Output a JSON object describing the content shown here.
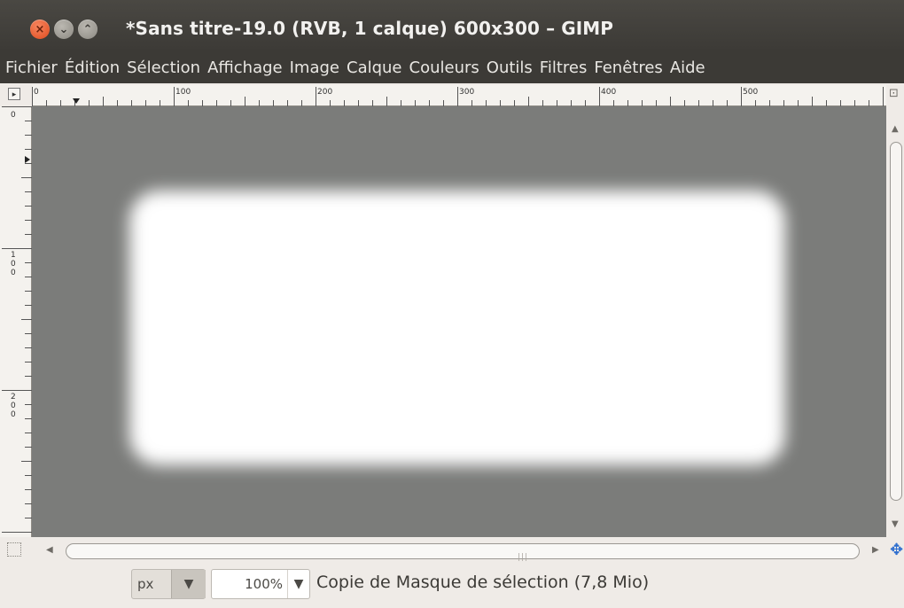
{
  "window": {
    "title": "*Sans titre-19.0 (RVB, 1 calque) 600x300 – GIMP",
    "buttons": {
      "close_glyph": "×",
      "minimize_glyph": "⌄",
      "maximize_glyph": "⌃"
    }
  },
  "menu": {
    "items": [
      "Fichier",
      "Édition",
      "Sélection",
      "Affichage",
      "Image",
      "Calque",
      "Couleurs",
      "Outils",
      "Filtres",
      "Fenêtres",
      "Aide"
    ]
  },
  "rulers": {
    "horizontal_labels": [
      "0",
      "100",
      "200",
      "300",
      "400",
      "500"
    ],
    "vertical_labels": [
      "0",
      "100",
      "200"
    ]
  },
  "icons": {
    "ruler_menu": "triangle-right-icon",
    "quick_mask": "quick-mask-icon",
    "zoom_toggle": "zoom-icon",
    "navigate": "navigate-icon",
    "scroll_left": "arrow-left-icon",
    "scroll_right": "arrow-right-icon",
    "scroll_up": "arrow-up-icon",
    "scroll_down": "arrow-down-icon"
  },
  "statusbar": {
    "unit": "px",
    "zoom": "100%",
    "message": "Copie de Masque de sélection (7,8 Mio)"
  },
  "colors": {
    "titlebar": "#3c3a36",
    "canvas_background": "#7b7c7a",
    "image_fill": "#ffffff",
    "close_button": "#df4a1d"
  }
}
